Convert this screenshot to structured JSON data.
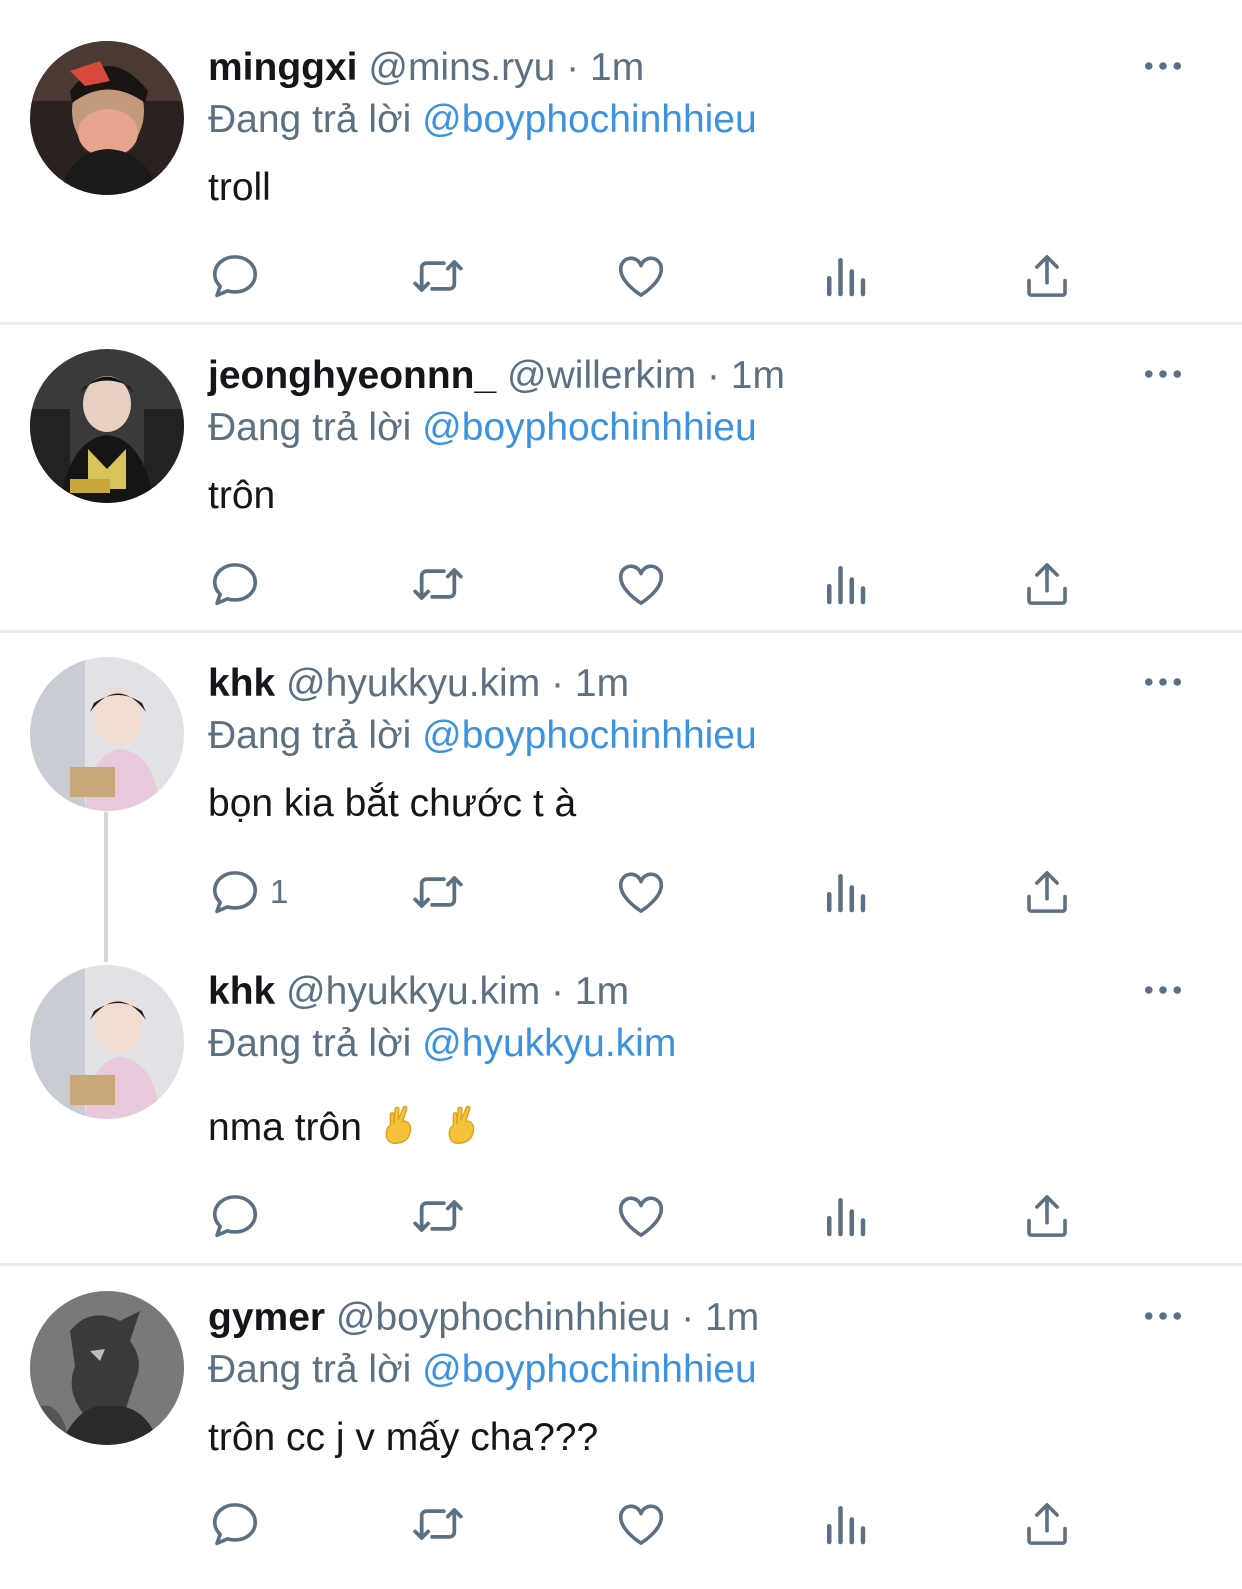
{
  "tweets": [
    {
      "name": "minggxi",
      "handle": "@mins.ryu",
      "time": "1m",
      "reply_prefix": "Đang trả lời",
      "reply_to": "@boyphochinhhieu",
      "text": "troll",
      "reply_count": "",
      "avatar": "avatar-minggxi"
    },
    {
      "name": "jeonghyeonnn_",
      "handle": "@willerkim",
      "time": "1m",
      "reply_prefix": "Đang trả lời",
      "reply_to": "@boyphochinhhieu",
      "text": "trôn",
      "reply_count": "",
      "avatar": "avatar-jeonghyeonnn"
    },
    {
      "name": "khk",
      "handle": "@hyukkyu.kim",
      "time": "1m",
      "reply_prefix": "Đang trả lời",
      "reply_to": "@boyphochinhhieu",
      "text": "bọn kia bắt chước t à",
      "reply_count": "1",
      "avatar": "avatar-khk"
    },
    {
      "name": "khk",
      "handle": "@hyukkyu.kim",
      "time": "1m",
      "reply_prefix": "Đang trả lời",
      "reply_to": "@hyukkyu.kim",
      "text": "nma trôn",
      "reply_count": "",
      "avatar": "avatar-khk"
    },
    {
      "name": "gymer",
      "handle": "@boyphochinhhieu",
      "time": "1m",
      "reply_prefix": "Đang trả lời",
      "reply_to": "@boyphochinhhieu",
      "text": "trôn cc j v mấy cha???",
      "reply_count": "",
      "avatar": "avatar-gymer"
    }
  ],
  "separator": "·",
  "icons": [
    "reply-icon",
    "retweet-icon",
    "like-icon",
    "analytics-icon",
    "share-icon",
    "more-icon",
    "crossed-fingers-emoji"
  ],
  "colors": {
    "accent": "#3b92e0",
    "muted": "#5b7083",
    "text": "#14171a",
    "divider": "#e6ecf0"
  }
}
